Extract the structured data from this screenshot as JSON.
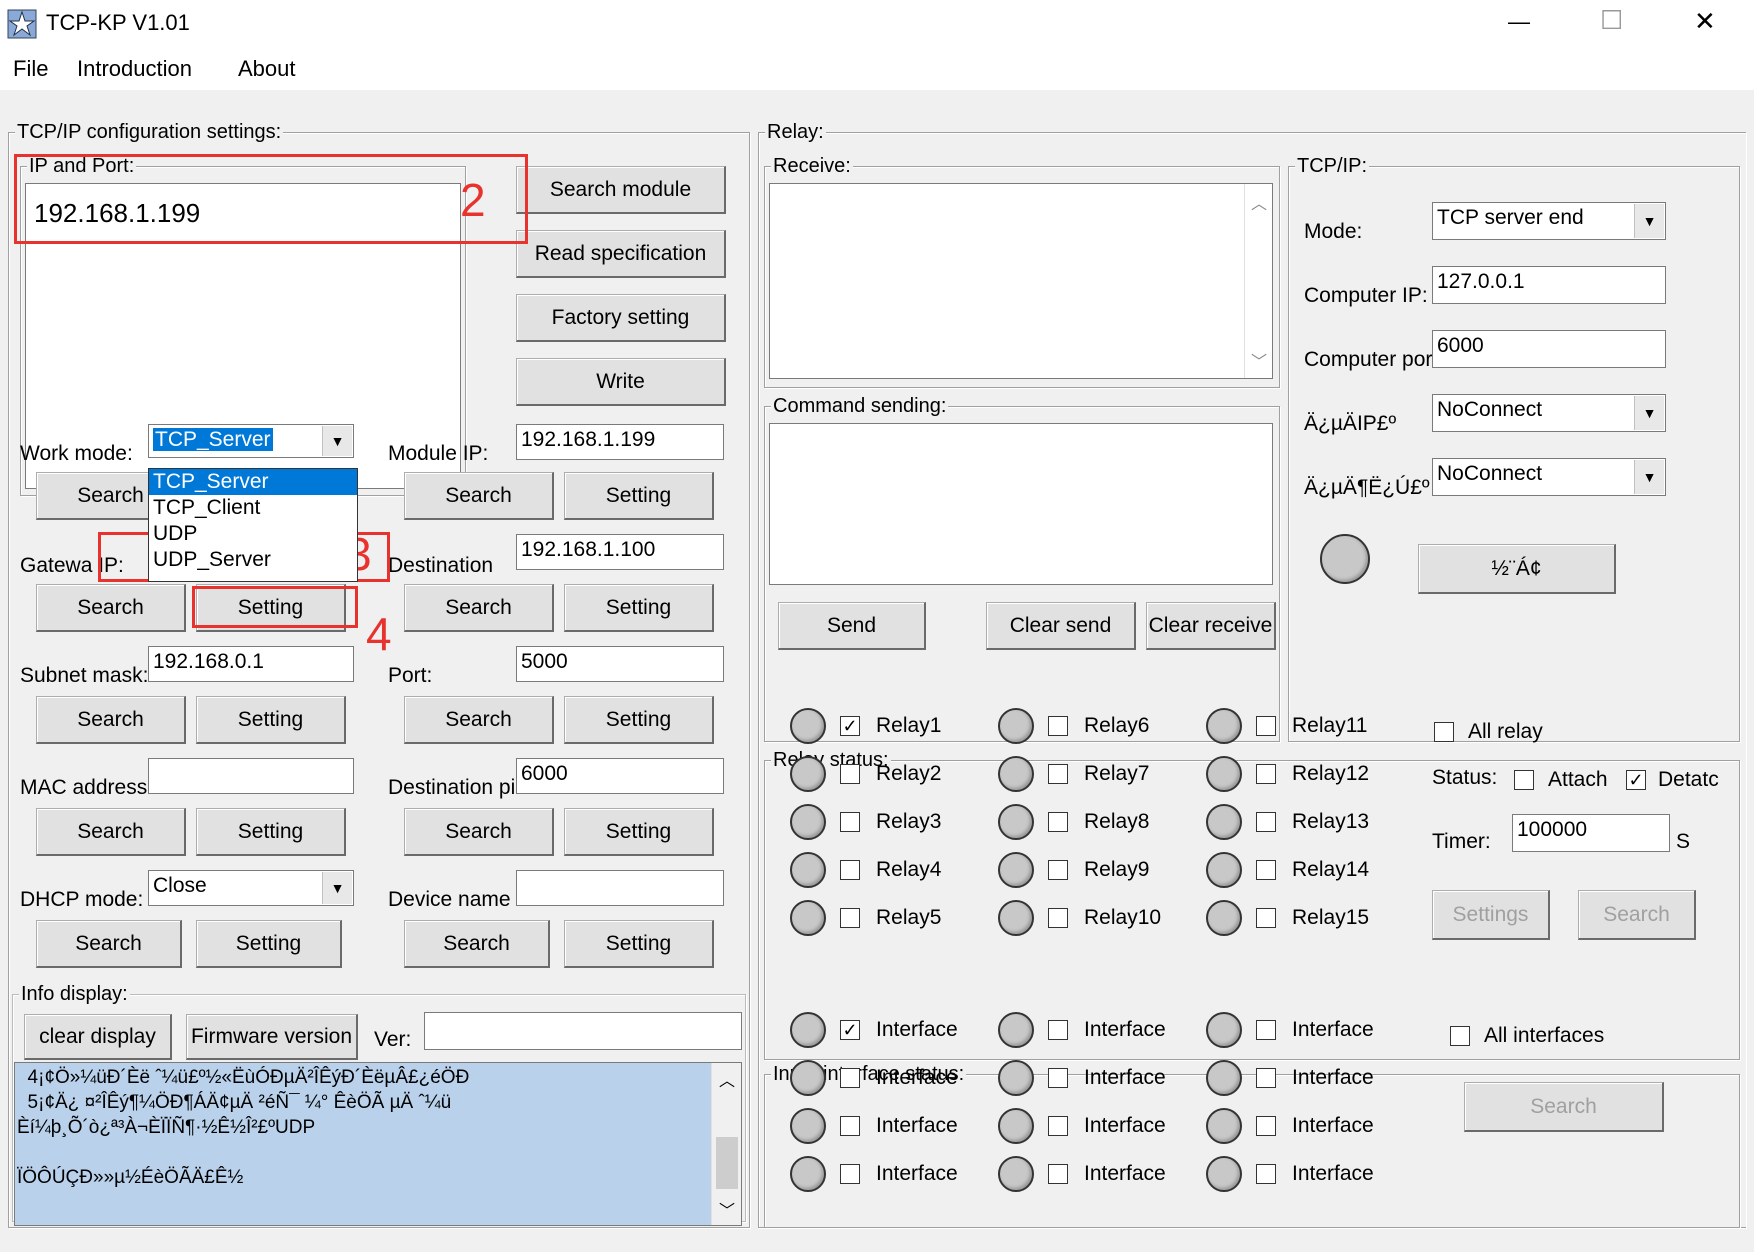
{
  "window": {
    "title": "TCP-KP V1.01",
    "minimize": "—",
    "maximize": "☐",
    "close": "✕"
  },
  "menu": [
    "File",
    "Introduction",
    "About"
  ],
  "tcpip_config": {
    "title": "TCP/IP configuration settings:",
    "ip_port_label": "IP and Port:",
    "ip_list_value": "192.168.1.199",
    "search_module": "Search module",
    "read_spec": "Read specification",
    "factory": "Factory setting",
    "write": "Write",
    "work_mode_label": "Work mode:",
    "work_mode_value": "TCP_Server",
    "work_mode_options": [
      "TCP_Server",
      "TCP_Client",
      "UDP",
      "UDP_Server"
    ],
    "module_ip_label": "Module IP:",
    "module_ip_value": "192.168.1.199",
    "gateway_label": "Gatewa IP:",
    "destination_label": "Destination",
    "destination_value": "192.168.1.100",
    "subnet_label": "Subnet mask:",
    "subnet_value": "192.168.0.1",
    "port_label": "Port:",
    "port_value": "5000",
    "mac_label": "MAC address",
    "dest_port_label": "Destination pi",
    "dest_port_value": "6000",
    "dhcp_label": "DHCP mode:",
    "dhcp_value": "Close",
    "device_label": "Device name",
    "search": "Search",
    "setting": "Setting"
  },
  "info": {
    "title": "Info display:",
    "clear": "clear display",
    "firmware": "Firmware version",
    "ver_label": "Ver:",
    "lines": [
      "  4¡¢Ö»¼üÐ´Èë ˆ¼ü£º½«ËùÓÐµÄ²ÎÊýÐ´ÈëµÂ£¿éÖÐ",
      "  5¡¢Ä¿ ¤²ÎÊý¶¼ÖÐ¶ÁÄ¢µÄ ²éÑ¯ ¼° ÊèÖÃ µÄ ˆ¼ü",
      "Èí¼þ¸Õ´ò¿ª³À¬ÈÏÏÑ¶·½Ê½Î²£ºUDP",
      "",
      "ÏÖÔÚÇÐ»»µ½ÉèÖÃÄ£Ê½"
    ]
  },
  "relay": {
    "title": "Relay:",
    "receive": "Receive:",
    "command": "Command sending:",
    "send": "Send",
    "clear_send": "Clear send",
    "clear_receive": "Clear receive",
    "tcpip_title": "TCP/IP:",
    "mode_label": "Mode:",
    "mode_value": "TCP server end",
    "computer_ip_label": "Computer IP:",
    "computer_ip_value": "127.0.0.1",
    "computer_port_label": "Computer por",
    "computer_port_value": "6000",
    "target_ip_label": "Ä¿µÄIP£º",
    "target_ip_value": "NoConnect",
    "target_port_label": "Ä¿µÄ¶Ë¿Ú£º",
    "target_port_value": "NoConnect",
    "connect": "½¨Á¢"
  },
  "relay_status": {
    "title": "Relay status:",
    "relays": [
      {
        "label": "Relay1",
        "checked": true
      },
      {
        "label": "Relay2",
        "checked": false
      },
      {
        "label": "Relay3",
        "checked": false
      },
      {
        "label": "Relay4",
        "checked": false
      },
      {
        "label": "Relay5",
        "checked": false
      },
      {
        "label": "Relay6",
        "checked": false
      },
      {
        "label": "Relay7",
        "checked": false
      },
      {
        "label": "Relay8",
        "checked": false
      },
      {
        "label": "Relay9",
        "checked": false
      },
      {
        "label": "Relay10",
        "checked": false
      },
      {
        "label": "Relay11",
        "checked": false
      },
      {
        "label": "Relay12",
        "checked": false
      },
      {
        "label": "Relay13",
        "checked": false
      },
      {
        "label": "Relay14",
        "checked": false
      },
      {
        "label": "Relay15",
        "checked": false
      }
    ],
    "all_relay": "All relay",
    "status_label": "Status:",
    "attach": "Attach",
    "detach": "Detatc",
    "timer_label": "Timer:",
    "timer_value": "100000",
    "timer_unit": "S",
    "settings": "Settings",
    "search": "Search"
  },
  "input_status": {
    "title": "Input interface status:",
    "interface": "Interface",
    "all": "All interfaces",
    "search": "Search",
    "first_checked": true
  },
  "annotations": {
    "n2": "2",
    "n3": "3",
    "n4": "4"
  }
}
